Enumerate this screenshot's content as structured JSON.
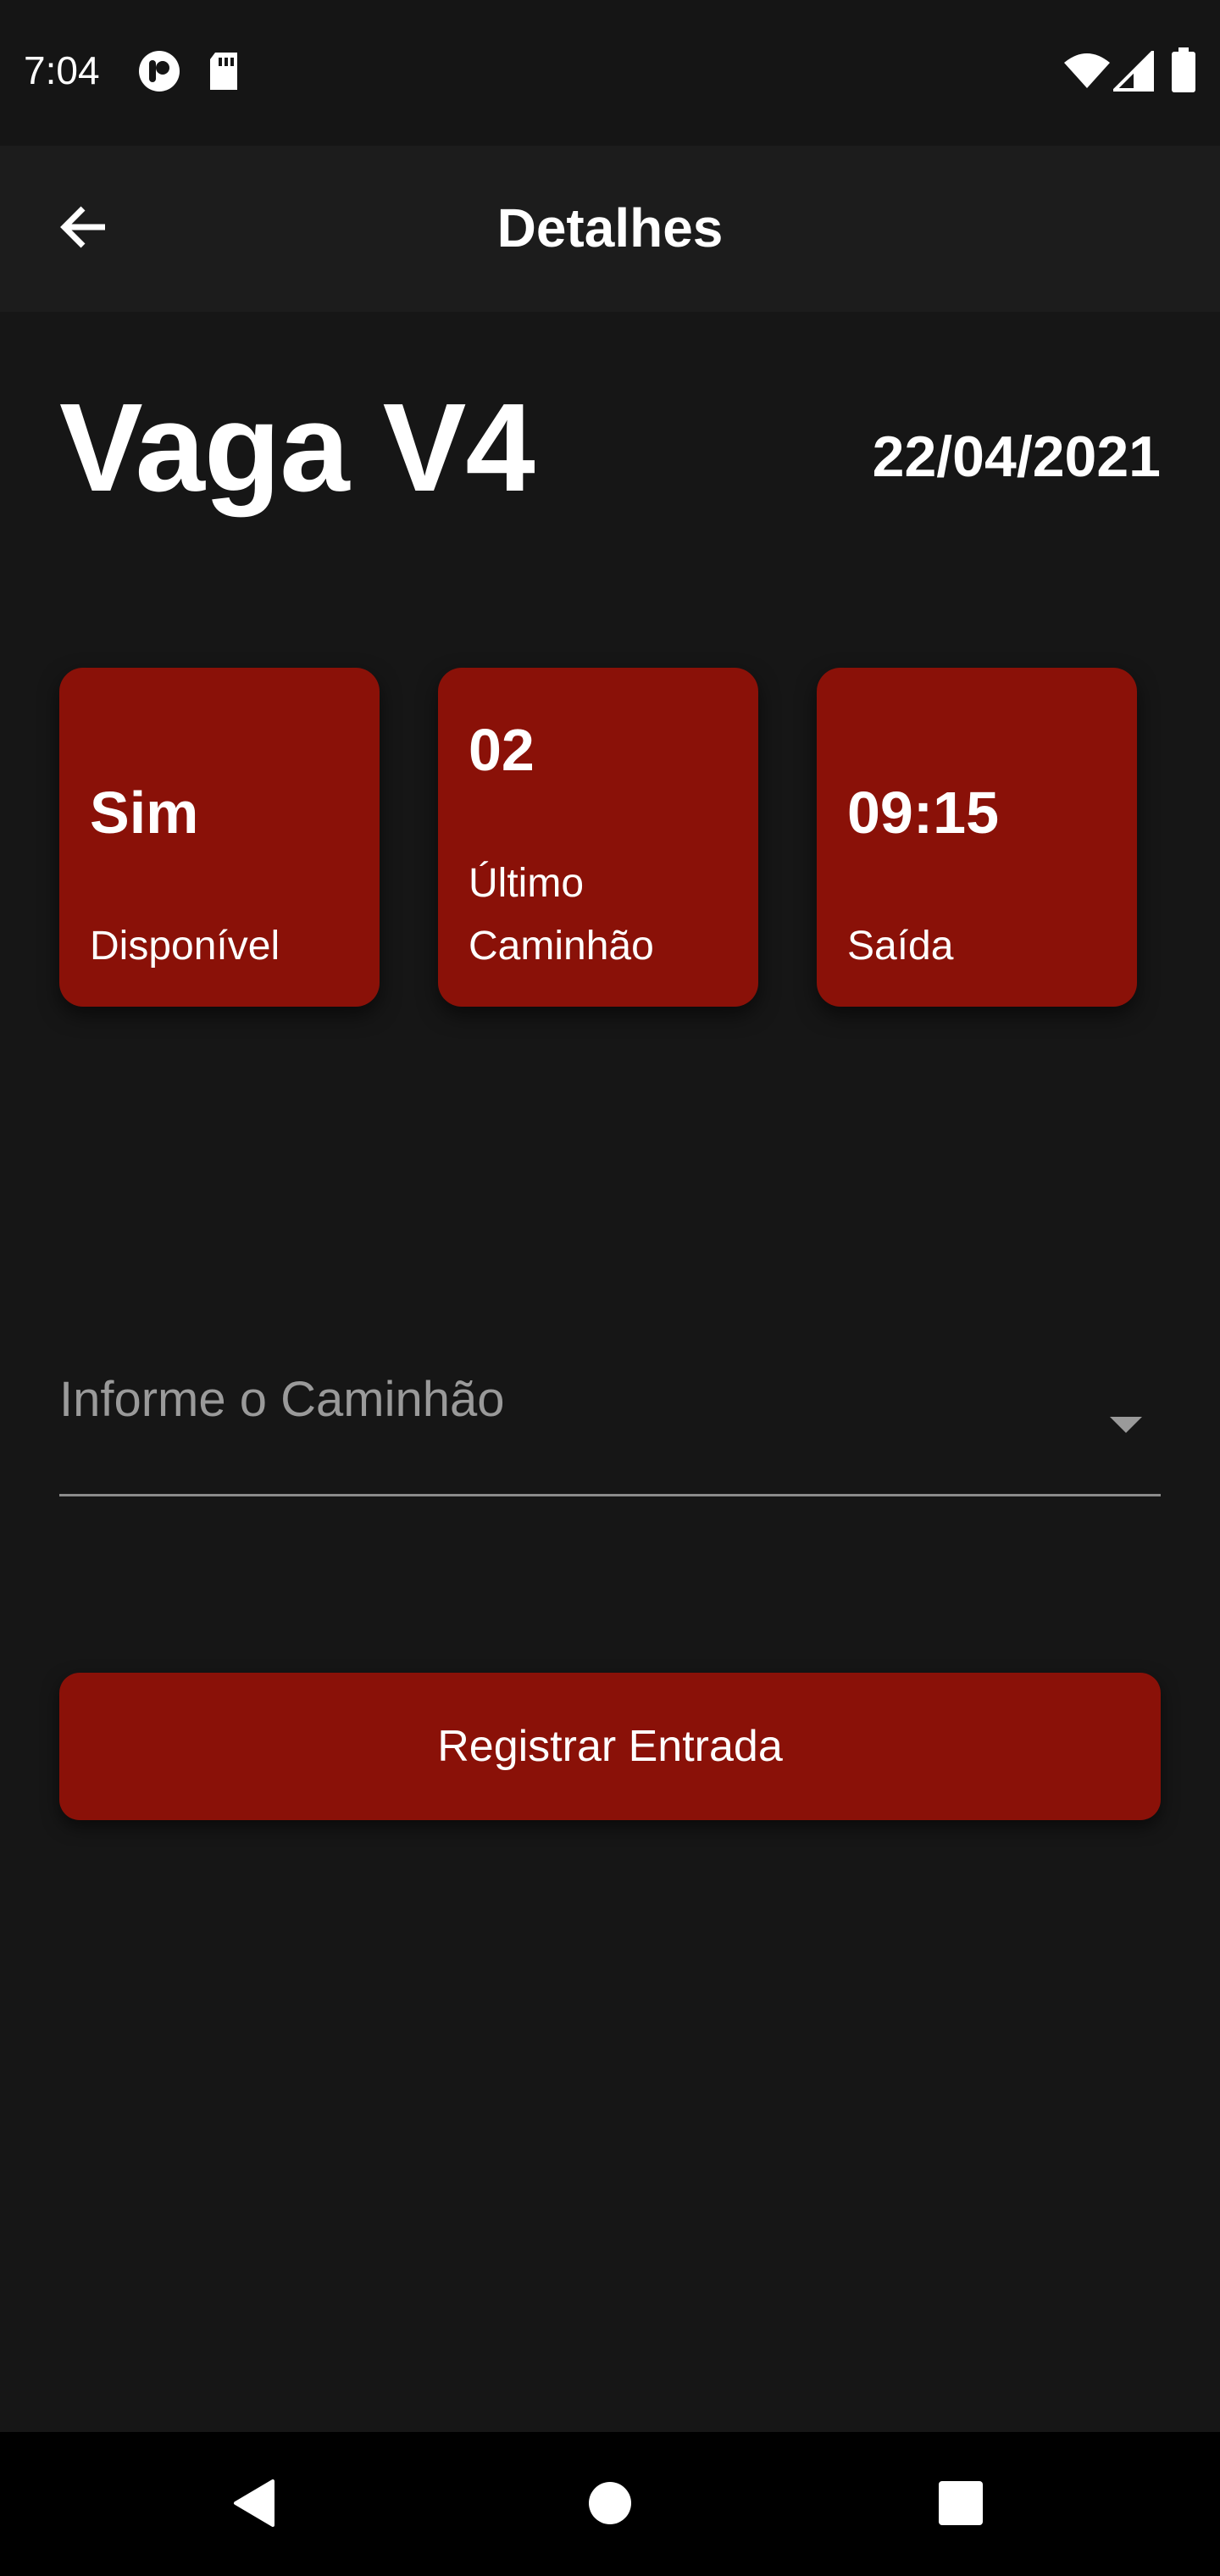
{
  "status_bar": {
    "time": "7:04",
    "left_icons": [
      "app-notification-icon",
      "sd-card-icon"
    ],
    "right_icons": [
      "wifi-icon",
      "cell-signal-icon",
      "battery-icon"
    ]
  },
  "app_bar": {
    "back_icon": "arrow-left-icon",
    "title": "Detalhes"
  },
  "header": {
    "title": "Vaga V4",
    "date": "22/04/2021"
  },
  "cards": [
    {
      "value": "Sim",
      "label": "Disponível"
    },
    {
      "value": "02",
      "label": "Último Caminhão"
    },
    {
      "value": "09:15",
      "label": "Saída"
    }
  ],
  "dropdown": {
    "placeholder": "Informe o Caminhão",
    "icon": "caret-down-icon"
  },
  "action_button": {
    "label": "Registrar Entrada"
  },
  "nav_bar": {
    "icons": [
      "back-triangle-icon",
      "home-circle-icon",
      "recents-square-icon"
    ]
  },
  "colors": {
    "background": "#161616",
    "app_bar": "#1c1c1c",
    "accent": "#8a1108",
    "text": "#ffffff",
    "muted": "#9a9a9a"
  }
}
